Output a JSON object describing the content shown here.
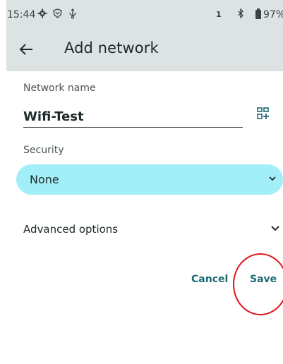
{
  "status_bar": {
    "time": "15:44",
    "icons": [
      "gear-icon",
      "shield-icon",
      "usb-icon",
      "sim-icon",
      "bluetooth-icon",
      "battery-icon"
    ],
    "sim_label": "1",
    "battery_percent": "97%"
  },
  "header": {
    "title": "Add network",
    "back_icon": "arrow-back-icon"
  },
  "form": {
    "network_name_label": "Network name",
    "network_name_value": "Wifi-Test",
    "qr_icon": "qr-code-icon",
    "security_label": "Security",
    "security_value": "None",
    "advanced_label": "Advanced options"
  },
  "actions": {
    "cancel_label": "Cancel",
    "save_label": "Save"
  },
  "annotation": {
    "highlight_color": "#e0151a"
  },
  "colors": {
    "appbar_bg": "#dde2e2",
    "select_bg": "#a2eef9",
    "accent": "#1b6b73"
  }
}
